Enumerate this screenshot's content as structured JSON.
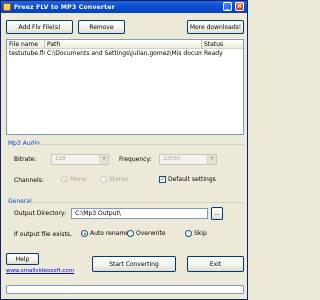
{
  "window": {
    "title": "Freez FLV to MP3 Converter"
  },
  "toolbar": {
    "add_label": "Add Flv File(s)",
    "remove_label": "Remove",
    "more_label": "More downloads!"
  },
  "file_list": {
    "columns": [
      "File name",
      "Path",
      "Status"
    ],
    "rows": [
      {
        "name": "testutube.flv",
        "path": "C:\\Documents and Settings\\julian.gomez\\Mis documentos\\",
        "status": "Ready"
      }
    ]
  },
  "mp3_audio": {
    "title": "Mp3 Audio",
    "bitrate_label": "Bitrate:",
    "bitrate_value": "128",
    "frequency_label": "Frequency:",
    "frequency_value": "22050",
    "channels_label": "Channels:",
    "mono_label": "Mono",
    "stereo_label": "Stereo",
    "default_settings_label": "Default settings",
    "default_settings_checked": true
  },
  "general": {
    "title": "General",
    "output_dir_label": "Output Directory:",
    "output_dir_value": "C:\\Mp3 Output\\",
    "browse_label": "...",
    "exists_label": "If output file exists,",
    "auto_rename_label": "Auto rename",
    "overwrite_label": "Overwrite",
    "skip_label": "Skip"
  },
  "footer": {
    "help_label": "Help",
    "link_text": "www.smallvideosoft.com",
    "start_label": "Start Converting",
    "exit_label": "Exit"
  },
  "progress": {
    "value": 0
  },
  "icons": {
    "app": "app-icon",
    "minimize": "minimize-icon",
    "close": "close-icon",
    "dropdown": "chevron-down-icon"
  }
}
